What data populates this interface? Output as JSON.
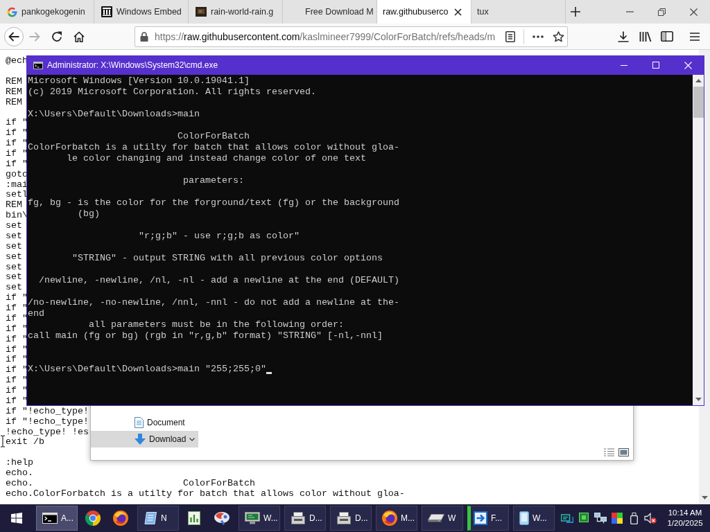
{
  "browser": {
    "tabs": [
      {
        "label": "pankogekogenin",
        "selected": false
      },
      {
        "label": "Windows Embed",
        "selected": false
      },
      {
        "label": "rain-world-rain.g",
        "selected": false
      },
      {
        "label": "Free Download M",
        "selected": false
      },
      {
        "label": "raw.githubuserco",
        "selected": true
      },
      {
        "label": "tux",
        "selected": false
      }
    ],
    "url": {
      "scheme": "https://",
      "host": "raw.githubusercontent.com",
      "path": "/kaslmineer7999/ColorForBatch/refs/heads/m"
    },
    "page_text": [
      [
        "@ech"
      ],
      [
        "REM",
        "REM",
        "REM"
      ],
      [
        "if \"",
        "if \"",
        "if \"",
        "if \"",
        "if \"",
        "goto",
        ":mai",
        "setl",
        "REM",
        "bin\\",
        "set",
        "set",
        "set",
        "set",
        "set",
        "set",
        "set",
        "if \"",
        "if \"",
        "if \"",
        "if \"",
        "if \"",
        "if \"",
        "if \"",
        "if \"",
        "if \"",
        "if \"",
        "if \"",
        "if \"!echo_type!",
        "if \"!echo_type!",
        "!echo_type! !es",
        "exit /b"
      ],
      [
        ":help",
        "echo.",
        "echo.                           ColorForBatch",
        "echo.ColorForbatch is a utilty for batch that allows color without gloa-"
      ]
    ]
  },
  "explorer": {
    "nav_items": [
      {
        "label": "Document",
        "selected": false
      },
      {
        "label": "Download",
        "selected": true
      }
    ]
  },
  "console": {
    "title": "Administrator: X:\\Windows\\System32\\cmd.exe",
    "blocks": [
      [
        "Microsoft Windows [Version 10.0.19041.1]",
        "(c) 2019 Microsoft Corporation. All rights reserved."
      ],
      [
        "X:\\Users\\Default\\Downloads>main"
      ],
      [
        "                           ColorForBatch",
        "ColorForbatch is a utilty for batch that allows color without gloa-",
        "       le color changing and instead change color of one text"
      ],
      [
        "                            parameters:"
      ],
      [
        "fg, bg - is the color for the forground/text (fg) or the background",
        "         (bg)"
      ],
      [
        "                    \"r;g;b\" - use r;g;b as color\""
      ],
      [
        "        \"STRING\" - output STRING with all previous color options"
      ],
      [
        "  /newline, -newline, /nl, -nl - add a newline at the end (DEFAULT)"
      ],
      [
        "/no-newline, -no-newline, /nnl, -nnl - do not add a newline at the-",
        "end",
        "           all parameters must be in the following order:",
        "call main (fg or bg) (rgb in \"r,g,b\" format) \"STRING\" [-nl,-nnl]"
      ]
    ],
    "prompt": "X:\\Users\\Default\\Downloads>main \"255;255;0\"",
    "cursor": true
  },
  "taskbar": {
    "items": [
      {
        "label": "A...",
        "selected": true,
        "highlighted": false
      },
      {
        "selected": false,
        "highlighted": false
      },
      {
        "selected": false,
        "highlighted": false
      },
      {
        "label": "N",
        "selected": false,
        "highlighted": false
      },
      {
        "selected": false,
        "highlighted": false
      },
      {
        "selected": false,
        "highlighted": false
      },
      {
        "label": "W...",
        "selected": false,
        "highlighted": false
      },
      {
        "label": "D...",
        "selected": false,
        "highlighted": false
      },
      {
        "label": "D...",
        "selected": false,
        "highlighted": false
      },
      {
        "label": "M...",
        "selected": false,
        "highlighted": false
      },
      {
        "label": "W",
        "selected": false,
        "highlighted": false
      },
      {
        "label": "F...",
        "selected": false,
        "highlighted": true
      },
      {
        "label": "W...",
        "selected": false,
        "highlighted": false
      }
    ],
    "time": "10:14 AM",
    "date": "1/20/2025"
  }
}
